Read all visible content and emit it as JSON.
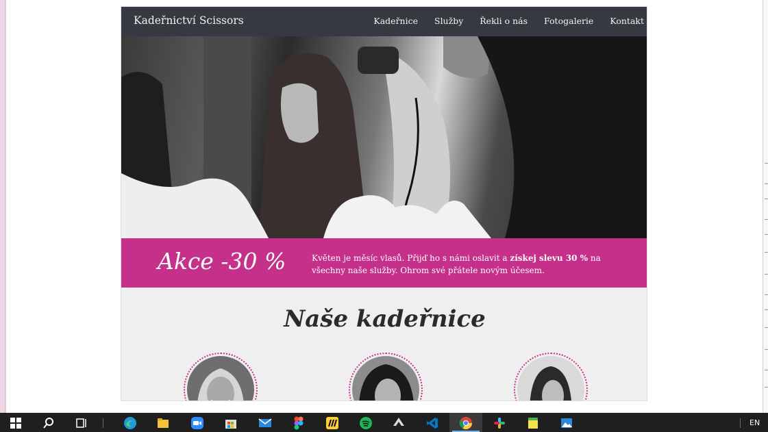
{
  "site": {
    "brand": "Kadeřnictví Scissors",
    "nav": [
      "Kadeřnice",
      "Služby",
      "Řekli o nás",
      "Fotogalerie",
      "Kontakt"
    ]
  },
  "promo": {
    "title": "Akce -30 %",
    "text_before": "Květen je měsíc vlasů. Přijď ho s námi oslavit a ",
    "text_bold": "získej slevu 30 %",
    "text_after": " na všechny naše služby. Ohrom své přátele novým účesem."
  },
  "section": {
    "title": "Naše kadeřnice"
  },
  "colors": {
    "nav_bg": "#343a40",
    "accent": "#c4308a",
    "page_bg": "#efefef"
  },
  "taskbar": {
    "icons": [
      "windows-start-icon",
      "search-icon",
      "task-view-icon",
      "edge-icon",
      "file-explorer-icon",
      "zoom-icon",
      "microsoft-store-icon",
      "mail-icon",
      "figma-icon",
      "miro-icon",
      "spotify-icon",
      "inkscape-icon",
      "vscode-icon",
      "chrome-icon",
      "slack-icon",
      "sticky-notes-icon",
      "photos-icon"
    ],
    "language": "EN"
  }
}
